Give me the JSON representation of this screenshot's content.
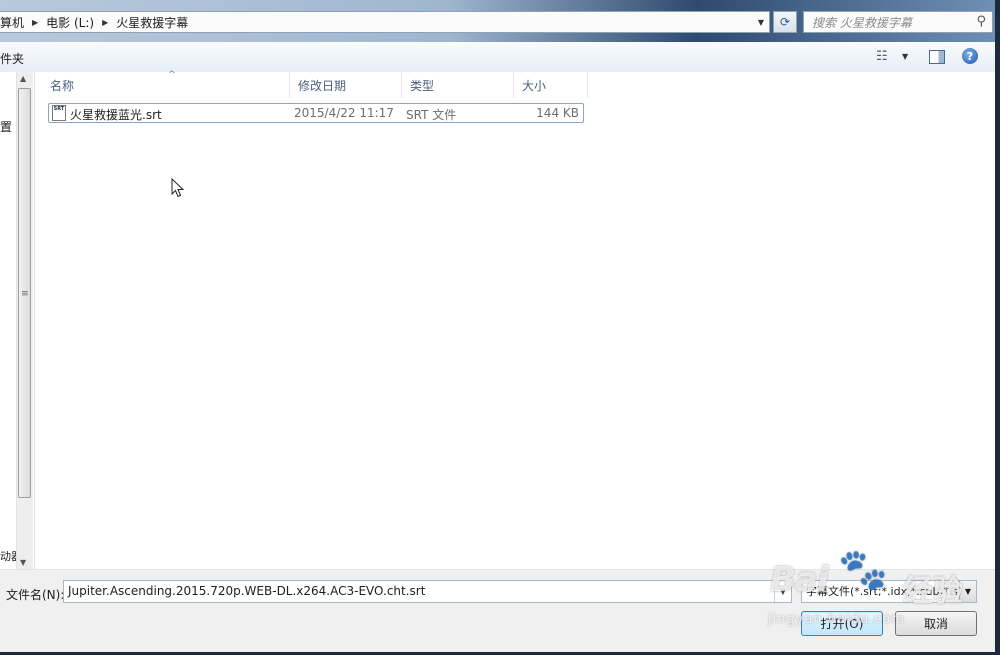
{
  "address_bar": {
    "crumbs": [
      "算机",
      "电影 (L:)",
      "火星救援字幕"
    ],
    "search_placeholder": "搜索 火星救援字幕"
  },
  "toolbar": {
    "new_folder_label": "件夹"
  },
  "nav_pane": {
    "item1": "置",
    "item2": "动器"
  },
  "file_list": {
    "columns": [
      "名称",
      "修改日期",
      "类型",
      "大小"
    ],
    "rows": [
      {
        "name": "火星救援蓝光.srt",
        "modified": "2015/4/22 11:17",
        "type": "SRT 文件",
        "size": "144 KB"
      }
    ]
  },
  "bottom": {
    "filename_label": "文件名(N):",
    "filename_value": "Jupiter.Ascending.2015.720p.WEB-DL.x264.AC3-EVO.cht.srt",
    "filter_value": "字幕文件(*.srt;*.idx;*.sub;*.sup",
    "open_label": "打开(O)",
    "cancel_label": "取消"
  },
  "watermark": {
    "brand": "Bai",
    "text": "经验",
    "url": "jingyan.baidu.com"
  },
  "colors": {
    "selected_border": "#8aa6c6",
    "header_text": "#4c607a",
    "primary_button": "#bee6fd"
  }
}
